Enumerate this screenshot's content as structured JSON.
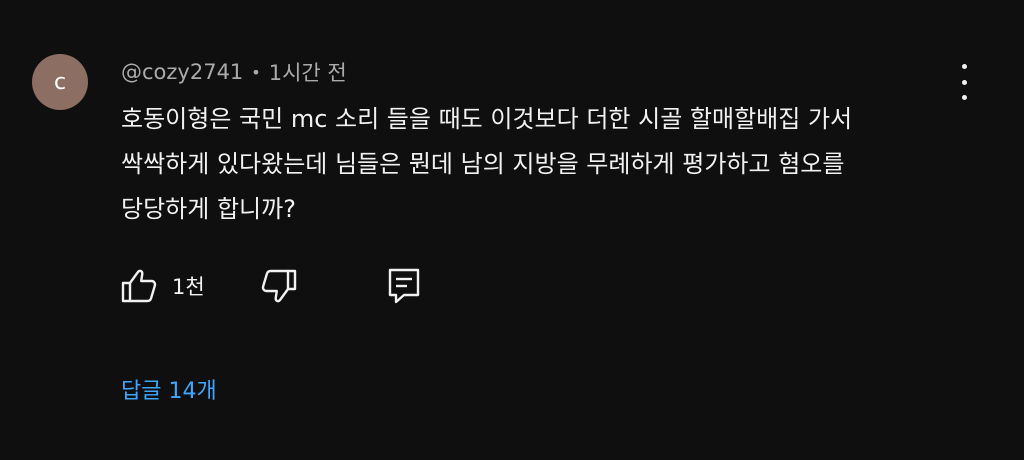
{
  "comment": {
    "avatar_letter": "c",
    "avatar_color": "#8d6e63",
    "author": "@cozy2741",
    "separator": "•",
    "time": "1시간 전",
    "text": "호동이형은 국민 mc 소리 들을 때도 이것보다 더한 시골 할매할배집 가서\n싹싹하게 있다왔는데 님들은 뭔데 남의 지방을 무례하게 평가하고 혐오를\n당당하게 합니까?",
    "like_count": "1천",
    "replies_label": "답글 14개",
    "accent_color": "#3ea6ff"
  },
  "icons": {
    "menu": "more-vertical-icon",
    "like": "thumbs-up-icon",
    "dislike": "thumbs-down-icon",
    "reply": "comment-reply-icon"
  }
}
